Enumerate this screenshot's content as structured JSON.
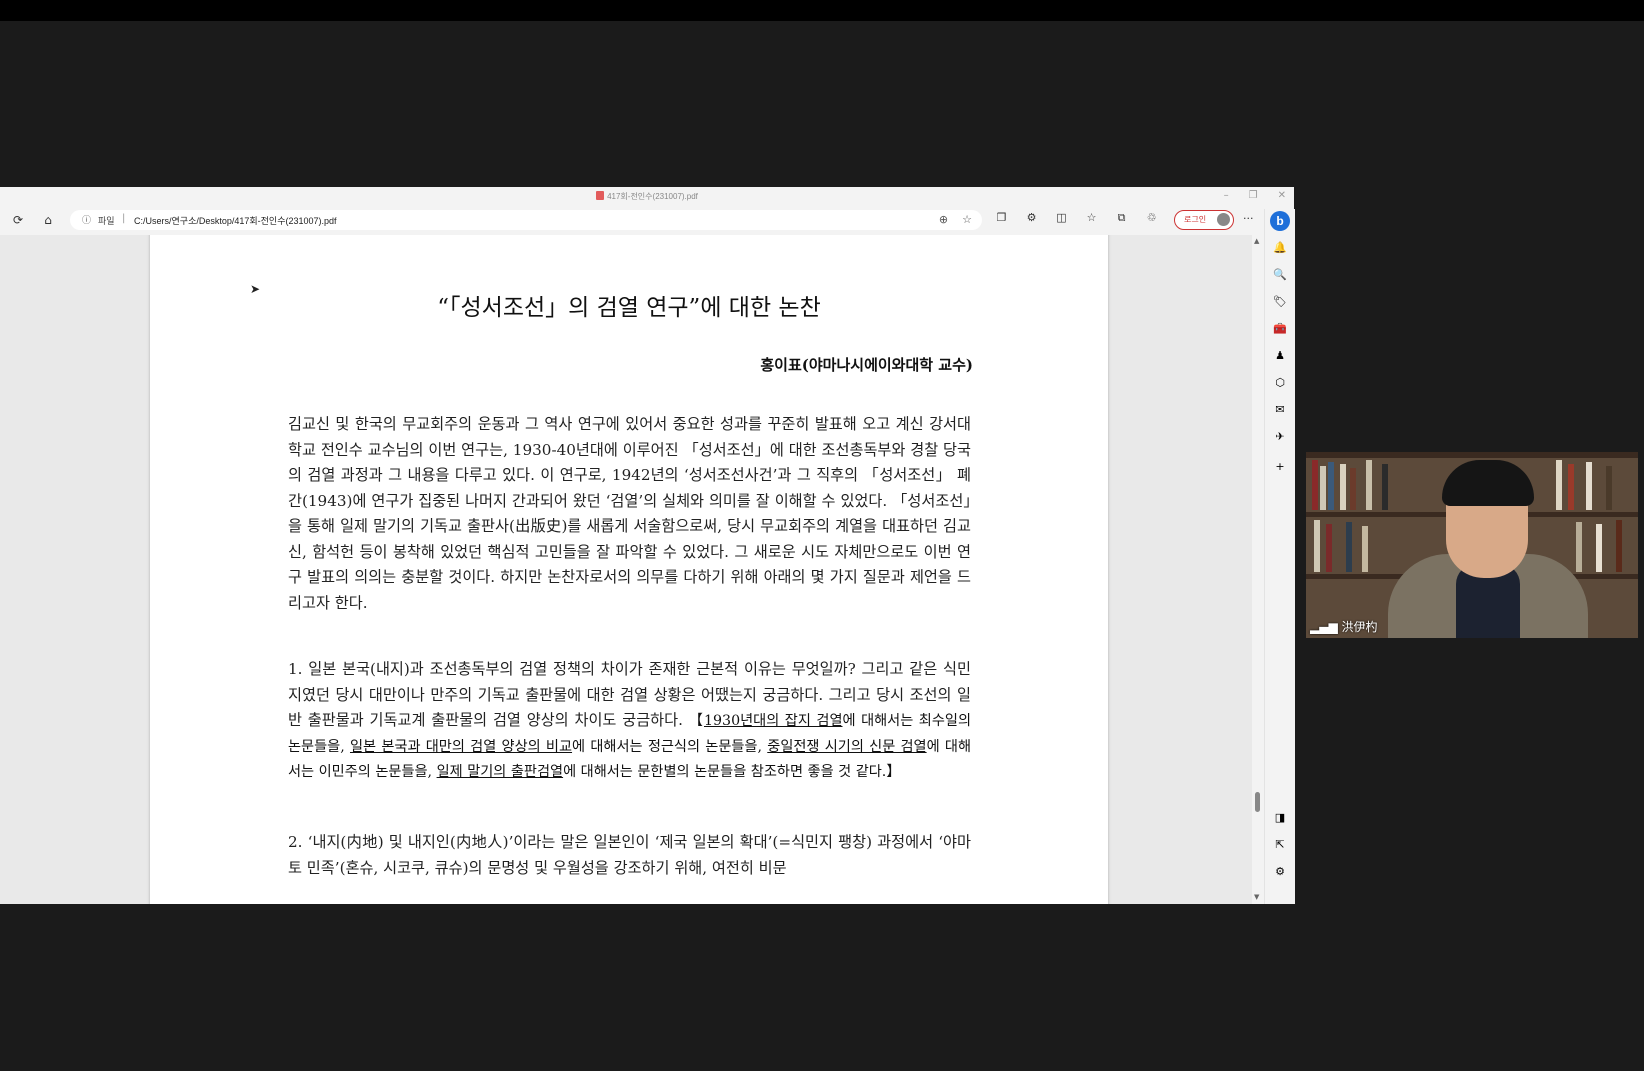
{
  "window": {
    "tab_title": "417회-전인수(231007).pdf",
    "controls": {
      "minimize": "–",
      "restore": "❐",
      "close": "✕"
    }
  },
  "toolbar": {
    "refresh_icon": "⟳",
    "home_icon": "⌂",
    "info_icon": "ⓘ",
    "file_label": "파일",
    "url": "C:/Users/연구소/Desktop/417회-전인수(231007).pdf",
    "zoom_icon": "⊕",
    "favorite_icon": "☆",
    "extensions": [
      "❐",
      "⚙",
      "◫",
      "☆",
      "⧉",
      "♲"
    ],
    "login_label": "로그인",
    "more_icon": "···"
  },
  "document": {
    "title": "“「성서조선」의 검열 연구”에 대한 논찬",
    "author": "홍이표(야마나시에이와대학 교수)",
    "paragraph1": "김교신 및 한국의 무교회주의 운동과 그 역사 연구에 있어서 중요한 성과를 꾸준히 발표해 오고 계신 강서대학교 전인수 교수님의 이번 연구는, 1930-40년대에 이루어진 「성서조선」에 대한 조선총독부와 경찰 당국의 검열 과정과 그 내용을 다루고 있다. 이 연구로, 1942년의 ‘성서조선사건’과 그 직후의 「성서조선」 폐간(1943)에 연구가 집중된 나머지 간과되어 왔던 ‘검열’의 실체와 의미를 잘 이해할 수 있었다. 「성서조선」을 통해 일제 말기의 기독교 출판사(出版史)를 새롭게 서술함으로써, 당시 무교회주의 계열을 대표하던 김교신, 함석헌 등이 봉착해 있었던 핵심적 고민들을 잘 파악할 수 있었다. 그 새로운 시도 자체만으로도 이번 연구 발표의 의의는 충분할 것이다. 하지만 논찬자로서의 의무를 다하기 위해 아래의 몇 가지 질문과 제언을 드리고자 한다.",
    "paragraph2": "1. 일본 본국(내지)과 조선총독부의 검열 정책의 차이가 존재한 근본적 이유는 무엇일까? 그리고 같은 식민지였던 당시 대만이나 만주의 기독교 출판물에 대한 검열 상황은 어땠는지 궁금하다. 그리고 당시 조선의 일반 출판물과 기독교계 출판물의 검열 양상의 차이도 궁금하다.",
    "bracket": {
      "open": "【",
      "u1": "1930년대의 잡지 검열",
      "t1": "에 대해서는 최수일의 논문들을, ",
      "u2": "일본 본국과 대만의 검열 양상의 비교",
      "t2": "에 대해서는 정근식의 논문들을, ",
      "u3": "중일전쟁 시기의 신문 검열",
      "t3": "에 대해서는 이민주의 논문들을, ",
      "u4": "일제 말기의 출판검열",
      "t4": "에 대해서는 문한별의 논문들을 참조하면 좋을 것 같다.",
      "close": "】"
    },
    "paragraph3": "2. ‘내지(内地) 및 내지인(内地人)’이라는 말은 일본인이 ‘제국 일본의 확대’(=식민지 팽창) 과정에서 ‘야마토 민족’(혼슈, 시코쿠, 큐슈)의 문명성 및 우월성을 강조하기 위해, 여전히 비문"
  },
  "sidebar": {
    "bing_label": "b",
    "icons": [
      "🔔",
      "🔍",
      "🏷",
      "🧰",
      "♟",
      "⬡",
      "✉",
      "✈",
      "+"
    ],
    "bottom_icons": [
      "◨",
      "⇱",
      "⚙"
    ]
  },
  "scrollbar": {
    "up": "▲",
    "down": "▼"
  },
  "video": {
    "signal_icon": "▂▄▆",
    "participant_name": "洪伊杓"
  },
  "colors": {
    "accent": "#1e6fd9",
    "login": "#cc3333"
  }
}
